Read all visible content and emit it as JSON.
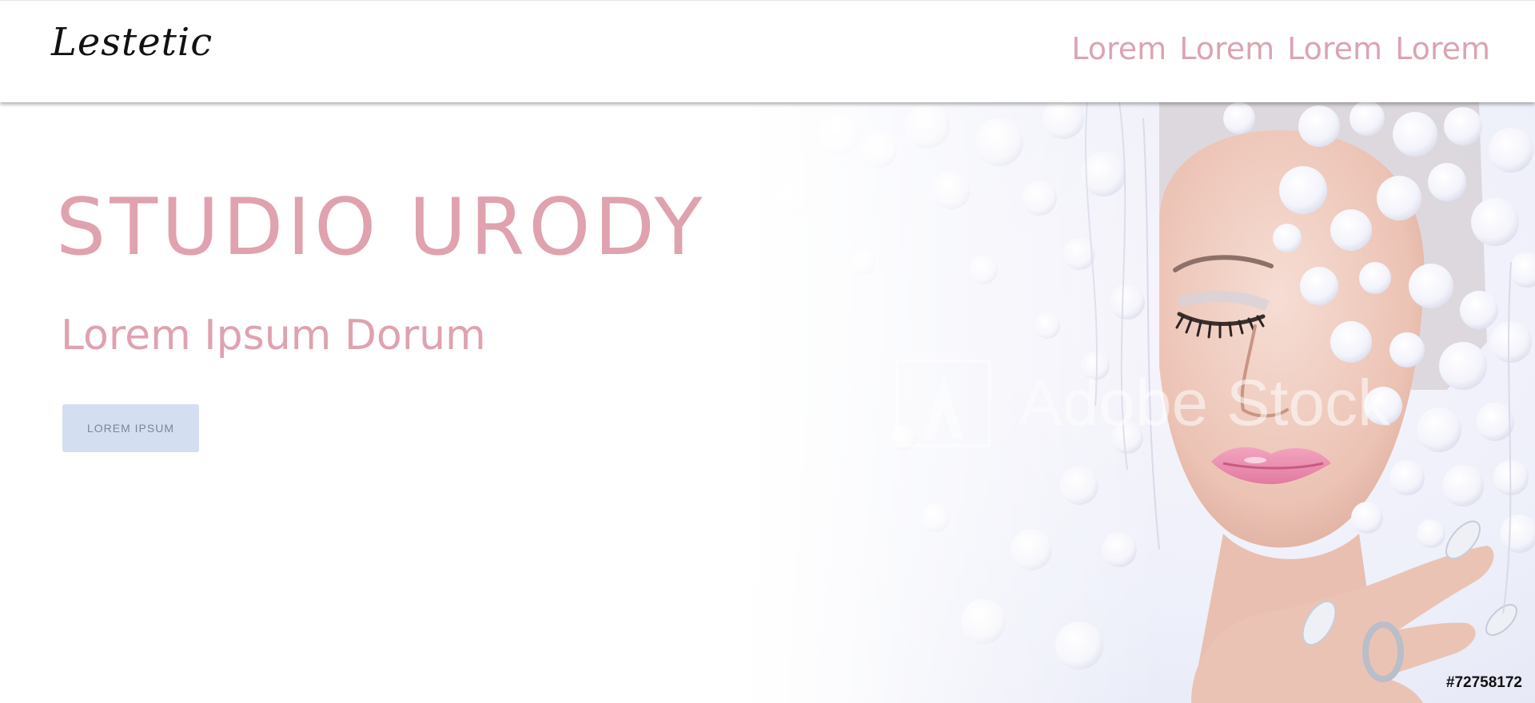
{
  "header": {
    "logo_text": "Lestetic",
    "nav": [
      "Lorem",
      "Lorem",
      "Lorem",
      "Lorem"
    ]
  },
  "hero": {
    "title": "STUDIO URODY",
    "subtitle": "Lorem Ipsum Dorum",
    "button_label": "LOREM IPSUM",
    "watermark_text": "Adobe Stock",
    "image_id": "#72758172"
  },
  "colors": {
    "accent_pink": "#dfa2ae",
    "button_bg": "#d3dff1",
    "button_text": "#7c8694",
    "logo_text": "#111111"
  }
}
